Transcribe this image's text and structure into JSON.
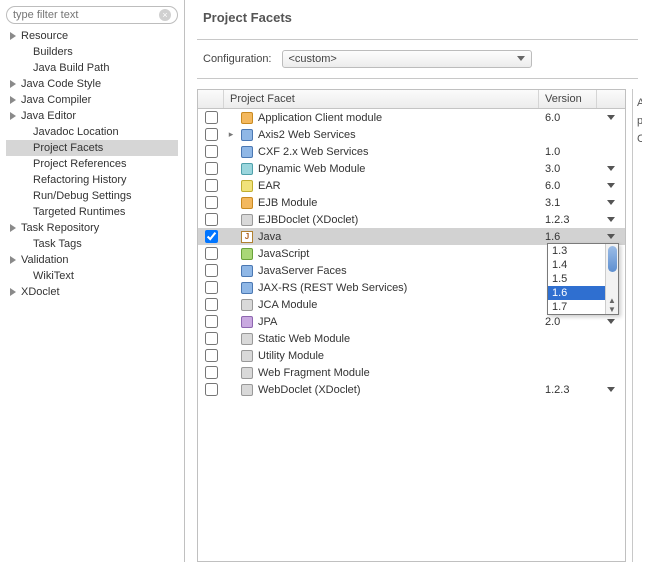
{
  "filter": {
    "placeholder": "type filter text"
  },
  "sidebar": {
    "items": [
      {
        "label": "Resource",
        "expandable": true,
        "children": [
          "Builders",
          "Java Build Path"
        ]
      },
      {
        "label": "Java Code Style",
        "expandable": true
      },
      {
        "label": "Java Compiler",
        "expandable": true
      },
      {
        "label": "Java Editor",
        "expandable": true,
        "children": [
          "Javadoc Location",
          "Project Facets",
          "Project References",
          "Refactoring History",
          "Run/Debug Settings",
          "Targeted Runtimes"
        ]
      },
      {
        "label": "Task Repository",
        "expandable": true,
        "children": [
          "Task Tags"
        ]
      },
      {
        "label": "Validation",
        "expandable": true,
        "children": [
          "WikiText"
        ]
      },
      {
        "label": "XDoclet",
        "expandable": true
      }
    ],
    "selected": "Project Facets"
  },
  "page_title": "Project Facets",
  "configuration": {
    "label": "Configuration:",
    "value": "<custom>"
  },
  "columns": {
    "facet": "Project Facet",
    "version": "Version"
  },
  "facets": [
    {
      "name": "Application Client module",
      "version": "6.0",
      "checked": false,
      "icon": "orange",
      "dd": true
    },
    {
      "name": "Axis2 Web Services",
      "version": "",
      "checked": false,
      "icon": "blue",
      "expandable": true,
      "dd": false
    },
    {
      "name": "CXF 2.x Web Services",
      "version": "1.0",
      "checked": false,
      "icon": "blue",
      "dd": false
    },
    {
      "name": "Dynamic Web Module",
      "version": "3.0",
      "checked": false,
      "icon": "cyan",
      "dd": true
    },
    {
      "name": "EAR",
      "version": "6.0",
      "checked": false,
      "icon": "yellow",
      "dd": true
    },
    {
      "name": "EJB Module",
      "version": "3.1",
      "checked": false,
      "icon": "orange",
      "dd": true
    },
    {
      "name": "EJBDoclet (XDoclet)",
      "version": "1.2.3",
      "checked": false,
      "icon": "gray",
      "dd": true
    },
    {
      "name": "Java",
      "version": "1.6",
      "checked": true,
      "icon": "j",
      "dd": true,
      "selected": true
    },
    {
      "name": "JavaScript",
      "version": "",
      "checked": false,
      "icon": "green",
      "dd": false
    },
    {
      "name": "JavaServer Faces",
      "version": "",
      "checked": false,
      "icon": "blue",
      "dd": false
    },
    {
      "name": "JAX-RS (REST Web Services)",
      "version": "",
      "checked": false,
      "icon": "blue",
      "dd": false
    },
    {
      "name": "JCA Module",
      "version": "",
      "checked": false,
      "icon": "gray",
      "dd": false
    },
    {
      "name": "JPA",
      "version": "2.0",
      "checked": false,
      "icon": "purple",
      "dd": true
    },
    {
      "name": "Static Web Module",
      "version": "",
      "checked": false,
      "icon": "gray",
      "dd": false
    },
    {
      "name": "Utility Module",
      "version": "",
      "checked": false,
      "icon": "gray",
      "dd": false
    },
    {
      "name": "Web Fragment Module",
      "version": "",
      "checked": false,
      "icon": "gray",
      "dd": false
    },
    {
      "name": "WebDoclet (XDoclet)",
      "version": "1.2.3",
      "checked": false,
      "icon": "gray",
      "dd": true
    }
  ],
  "version_dropdown": {
    "options": [
      "1.3",
      "1.4",
      "1.5",
      "1.6",
      "1.7"
    ],
    "highlighted": "1.6"
  },
  "side_hints": [
    "A",
    "p",
    "C"
  ]
}
